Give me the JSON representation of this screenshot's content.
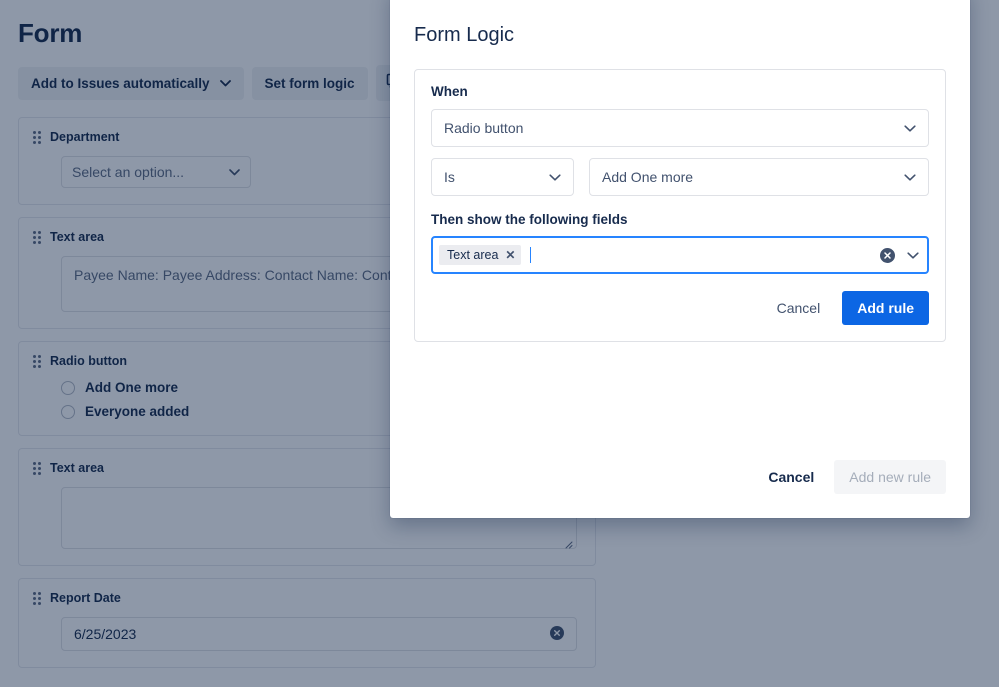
{
  "page": {
    "title": "Form",
    "toolbar": {
      "add_to_issues_label": "Add to Issues automatically",
      "set_form_logic_label": "Set form logic",
      "preview_icon": "preview-monitor-icon"
    },
    "fields": [
      {
        "label": "Department",
        "type": "select",
        "placeholder": "Select an option...",
        "value": ""
      },
      {
        "label": "Text area",
        "type": "textarea",
        "placeholder": "Payee Name: Payee Address: Contact Name: Contact ID",
        "value": ""
      },
      {
        "label": "Radio button",
        "type": "radio",
        "options": [
          "Add One more",
          "Everyone added"
        ]
      },
      {
        "label": "Text area",
        "type": "textarea",
        "placeholder": "",
        "value": ""
      },
      {
        "label": "Report Date",
        "type": "date",
        "value": "6/25/2023",
        "clear_icon": "clear-circle-icon"
      }
    ]
  },
  "modal": {
    "title": "Form Logic",
    "rule": {
      "when_label": "When",
      "field_select": {
        "value": "Radio button",
        "chevron_icon": "chevron-down-icon"
      },
      "condition_select": {
        "value": "Is",
        "chevron_icon": "chevron-down-icon"
      },
      "value_select": {
        "value": "Add One more",
        "chevron_icon": "chevron-down-icon"
      },
      "then_label": "Then show the following fields",
      "fields_multiselect": {
        "chips": [
          "Text area"
        ],
        "chip_remove_icon": "close-x-icon",
        "clear_icon": "clear-circle-icon",
        "chevron_icon": "chevron-down-icon",
        "focused": true
      },
      "cancel_label": "Cancel",
      "add_rule_label": "Add rule"
    },
    "footer": {
      "cancel_label": "Cancel",
      "add_new_rule_label": "Add new rule",
      "add_new_rule_disabled": true
    }
  },
  "colors": {
    "primary": "#0c66e4",
    "focus_border": "#2684ff",
    "text": "#172b4d",
    "muted_text": "#5e6c84",
    "disabled_text": "#a5adba",
    "overlay": "rgba(9,30,66,0.46)",
    "chip_bg": "#ebecf0",
    "toolbar_btn_bg": "#f1f2f4"
  }
}
